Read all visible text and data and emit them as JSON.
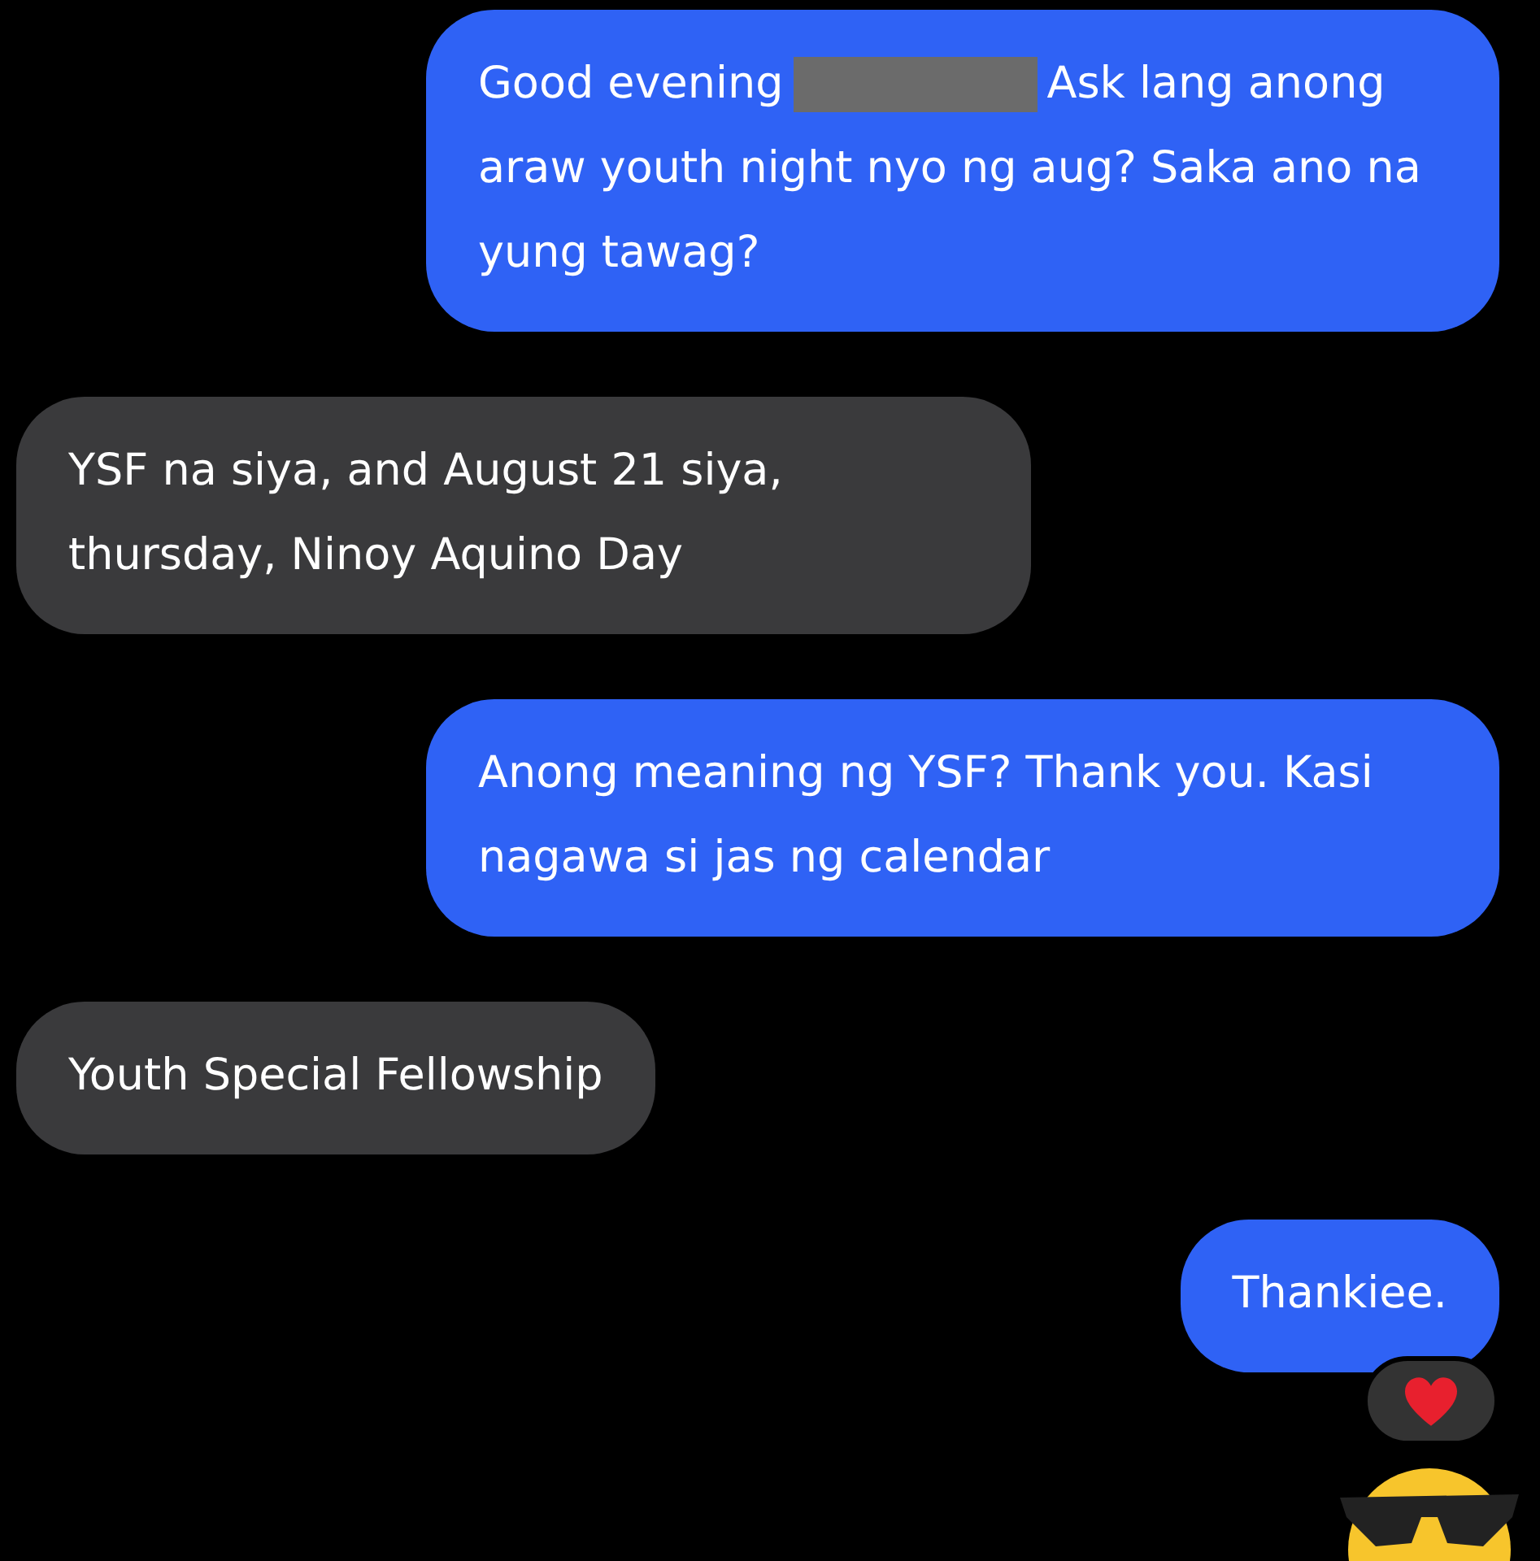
{
  "messages": [
    {
      "kind": "sent",
      "parts": [
        {
          "kind": "text",
          "text": "Good evening"
        },
        {
          "kind": "redacted"
        },
        {
          "kind": "text",
          "text": "Ask lang anong"
        },
        {
          "kind": "block",
          "text": "araw youth night nyo ng aug? Saka ano na yung tawag?"
        }
      ]
    },
    {
      "kind": "received",
      "parts": [
        {
          "kind": "block",
          "text": "YSF na siya, and August 21 siya, thursday, Ninoy Aquino Day"
        }
      ]
    },
    {
      "kind": "sent",
      "parts": [
        {
          "kind": "block",
          "text": "Anong meaning ng YSF? Thank you. Kasi nagawa si jas ng calendar"
        }
      ]
    },
    {
      "kind": "received",
      "parts": [
        {
          "kind": "block",
          "text": "Youth Special Fellowship"
        }
      ]
    },
    {
      "kind": "sent",
      "parts": [
        {
          "kind": "block",
          "text": "Thankiee."
        }
      ],
      "reaction": {
        "kind": "heart"
      }
    }
  ],
  "sticker": {
    "kind": "sunglasses-emoji"
  }
}
